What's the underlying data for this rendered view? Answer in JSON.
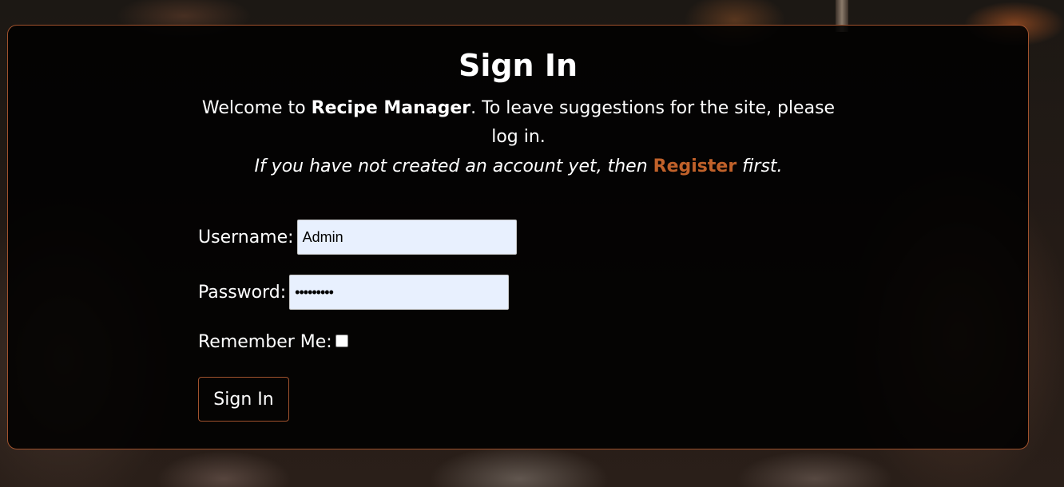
{
  "colors": {
    "accent": "#c0612a",
    "border": "#a0522d",
    "card_bg": "#000000",
    "text": "#ffffff",
    "input_bg": "#e8f0fe"
  },
  "page": {
    "title": "Sign In",
    "intro_prefix": "Welcome to ",
    "app_name": "Recipe Manager",
    "intro_suffix": ". To leave suggestions for the site, please log in.",
    "register_prefix": "If you have not created an account yet, then ",
    "register_link": "Register",
    "register_suffix": " first."
  },
  "form": {
    "username_label": "Username:",
    "username_value": "Admin",
    "password_label": "Password:",
    "password_value": "•••••••••",
    "remember_label": "Remember Me:",
    "remember_checked": false,
    "submit_label": "Sign In"
  }
}
